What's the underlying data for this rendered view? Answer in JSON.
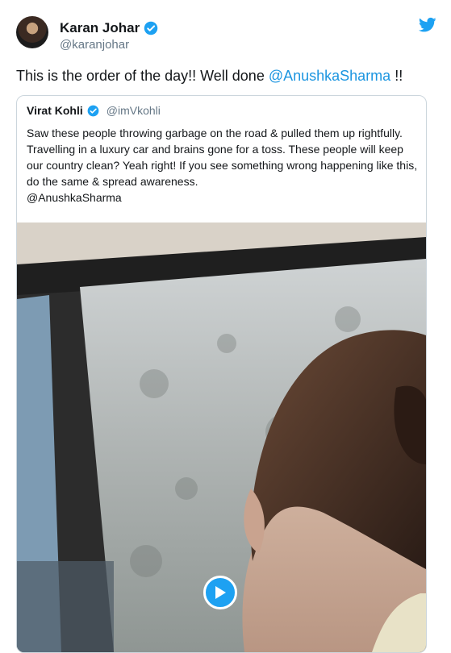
{
  "author": {
    "display_name": "Karan Johar",
    "handle": "@karanjohar"
  },
  "tweet": {
    "text_before": "This is the order of the day!! Well done ",
    "mention": "@AnushkaSharma",
    "text_after": " !!"
  },
  "quoted_tweet": {
    "display_name": "Virat Kohli",
    "handle": "@imVkohli",
    "text": "Saw these people throwing garbage on the road & pulled them up rightfully. Travelling in a luxury car and brains gone for a toss. These people will keep our country clean? Yeah right! If you see something wrong happening like this, do the same & spread awareness.",
    "mention": "@AnushkaSharma"
  },
  "icons": {
    "verified": "verified-badge-icon",
    "twitter": "twitter-bird-icon",
    "play": "play-icon"
  },
  "colors": {
    "link": "#1b95e0",
    "verified": "#1da1f2",
    "text": "#14171a",
    "secondary": "#657786"
  }
}
